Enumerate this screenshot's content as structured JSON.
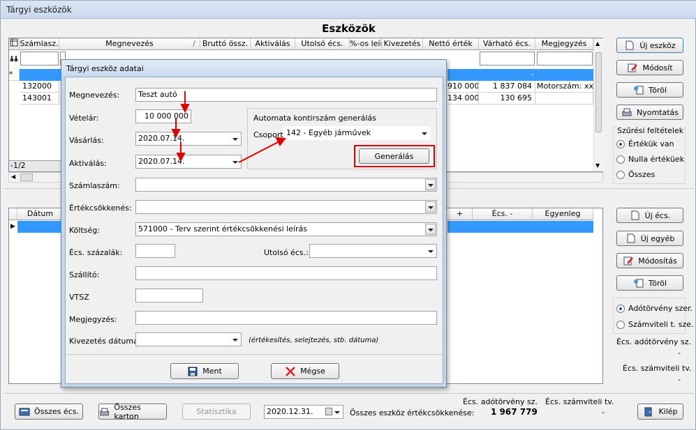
{
  "window": {
    "title": "Tárgyi eszközök"
  },
  "main": {
    "title": "Eszközök"
  },
  "assets_grid": {
    "columns": [
      "Számlasz.",
      "Megnevezés",
      "Bruttó össz.",
      "Aktiválás",
      "Utolsó écs.",
      "%-os leír.",
      "Kivezetés",
      "Nettó érték",
      "Várható écs.",
      "Megjegyzés"
    ],
    "sort_indicator": "/",
    "new_row_marker": "*",
    "new_row_dot": "-",
    "rows": [
      {
        "szamlasz": "132000",
        "netto": "910 000",
        "varhato": "1 837 084",
        "megjegyzes": "Motorszám: xxx"
      },
      {
        "szamlasz": "143001",
        "netto": "134 000",
        "varhato": "130 695",
        "megjegyzes": ""
      }
    ],
    "row_count": "-1/2"
  },
  "right_buttons": {
    "new": "Új eszköz",
    "modify": "Módosít",
    "delete": "Töröl",
    "print": "Nyomtatás"
  },
  "filter": {
    "title": "Szűrési feltételek",
    "options": [
      "Értékük van",
      "Nulla értéküek",
      "Összes"
    ],
    "selected": 0
  },
  "ledger_grid": {
    "columns": [
      "Dátum",
      "+",
      "Écs. -",
      "Egyenleg"
    ]
  },
  "ledger_buttons": {
    "new_ecs": "Új écs.",
    "new_other": "Új egyéb",
    "modify": "Módosítás",
    "delete": "Töröl"
  },
  "mode": {
    "options": [
      "Adótörvény szer.",
      "Számviteli t. sze."
    ],
    "selected": 0
  },
  "side_labels": {
    "ado_label": "Écs. adótörvény sz.",
    "ado_value": "-",
    "szamv_label": "Écs. számviteli tv.",
    "szamv_value": "-"
  },
  "bottom": {
    "osszes_ecs": "Összes écs.",
    "osszes_karton": "Összes karton",
    "statisztika": "Statisztika",
    "date": "2020.12.31.",
    "total_label": "Összes eszköz értékcsökkenése:",
    "ado_header": "Écs. adótörvény sz.",
    "szamv_header": "Écs. számviteli tv.",
    "ado_value": "1 967 779",
    "szamv_value": "-",
    "exit": "Kilép"
  },
  "dialog": {
    "title": "Tárgyi eszköz adatai",
    "labels": {
      "megnevezes": "Megnevezés:",
      "vetelar": "Vételár:",
      "vasarlas": "Vásárlás:",
      "aktivalas": "Aktiválás:",
      "szamlaszam": "Számlaszám:",
      "ertekcsokkenes": "Értékcsökkenés:",
      "koltseg": "Költség:",
      "ecs_szazalek": "Écs. százalák:",
      "utolso_ecs": "Utolsó écs.:",
      "szallito": "Szállító:",
      "vtsz": "VTSZ",
      "megjegyzes": "Megjegyzés:",
      "kivezetes": "Kivezetés dátuma:"
    },
    "values": {
      "megnevezes": "Teszt autó",
      "vetelar": "10 000 000",
      "vasarlas": "2020.07.14.",
      "aktivalas": "2020.07.14.",
      "koltseg": "571000 - Terv szerint értékcsökkenési leírás"
    },
    "auto_group": {
      "title": "Automata kontirszám generálás",
      "csoport_label": "Csoport:",
      "csoport_value": "142 - Egyéb járművek",
      "generate": "Generálás"
    },
    "kivezetes_hint": "(értékesítés, selejtezés, stb. dátuma)",
    "save": "Ment",
    "cancel": "Mégse"
  },
  "colors": {
    "selection": "#3399ff",
    "highlight": "#e00000"
  }
}
